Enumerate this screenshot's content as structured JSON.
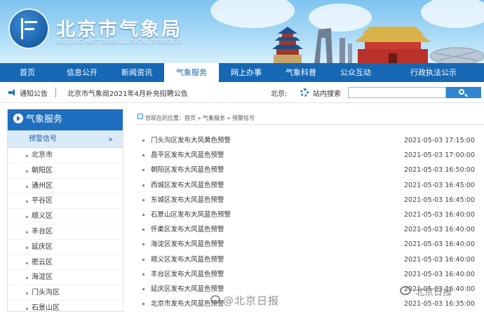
{
  "header": {
    "title": "北京市气象局",
    "subtitle": "BEIJING METEOROLOGICAL SERVICE"
  },
  "nav": {
    "items": [
      "首页",
      "信息公开",
      "新闻资讯",
      "气象服务",
      "网上办事",
      "气象科普",
      "公众互动",
      "行政执法公示"
    ],
    "active": "气象服务"
  },
  "notice": {
    "label": "通知公告",
    "text": "北京市气象局2021年4月补充招聘公告",
    "city": "北京:",
    "search_label": "站内搜索",
    "search_value": ""
  },
  "sidebar": {
    "heading": "气象服务",
    "sub_heading": "预警信号",
    "sub_chevron": "»",
    "items": [
      "北京市",
      "朝阳区",
      "通州区",
      "平谷区",
      "顺义区",
      "丰台区",
      "延庆区",
      "密云区",
      "海淀区",
      "门头沟区",
      "石景山区"
    ]
  },
  "breadcrumb": "您现在的位置：首页 » 气象服务 » 预警信号",
  "alerts": [
    {
      "title": "门头沟区发布大风黄色预警",
      "date": "2021-05-03 17:15:00"
    },
    {
      "title": "昌平区发布大风蓝色预警",
      "date": "2021-05-03 17:00:00"
    },
    {
      "title": "朝阳区发布大风蓝色预警",
      "date": "2021-05-03 16:50:00"
    },
    {
      "title": "西城区发布大风蓝色预警",
      "date": "2021-05-03 16:45:00"
    },
    {
      "title": "东城区发布大风蓝色预警",
      "date": "2021-05-03 16:45:00"
    },
    {
      "title": "石景山区发布大风蓝色预警",
      "date": "2021-05-03 16:40:00"
    },
    {
      "title": "怀柔区发布大风蓝色预警",
      "date": "2021-05-03 16:40:00"
    },
    {
      "title": "海淀区发布大风蓝色预警",
      "date": "2021-05-03 16:40:00"
    },
    {
      "title": "顺义区发布大风蓝色预警",
      "date": "2021-05-03 16:40:00"
    },
    {
      "title": "丰台区发布大风蓝色预警",
      "date": "2021-05-03 16:40:00"
    },
    {
      "title": "延庆区发布大风蓝色预警",
      "date": "2021-05-03 16:40:00"
    },
    {
      "title": "北京市发布大风蓝色预警",
      "date": "2021-05-03 16:35:00"
    }
  ],
  "watermark": {
    "text": "@北京日报",
    "corner": "北京日报"
  },
  "colors": {
    "nav_bg": "#1668b4",
    "sidebar_head": "#1e6fc0",
    "sidebar_sub": "#dbeaf7"
  }
}
